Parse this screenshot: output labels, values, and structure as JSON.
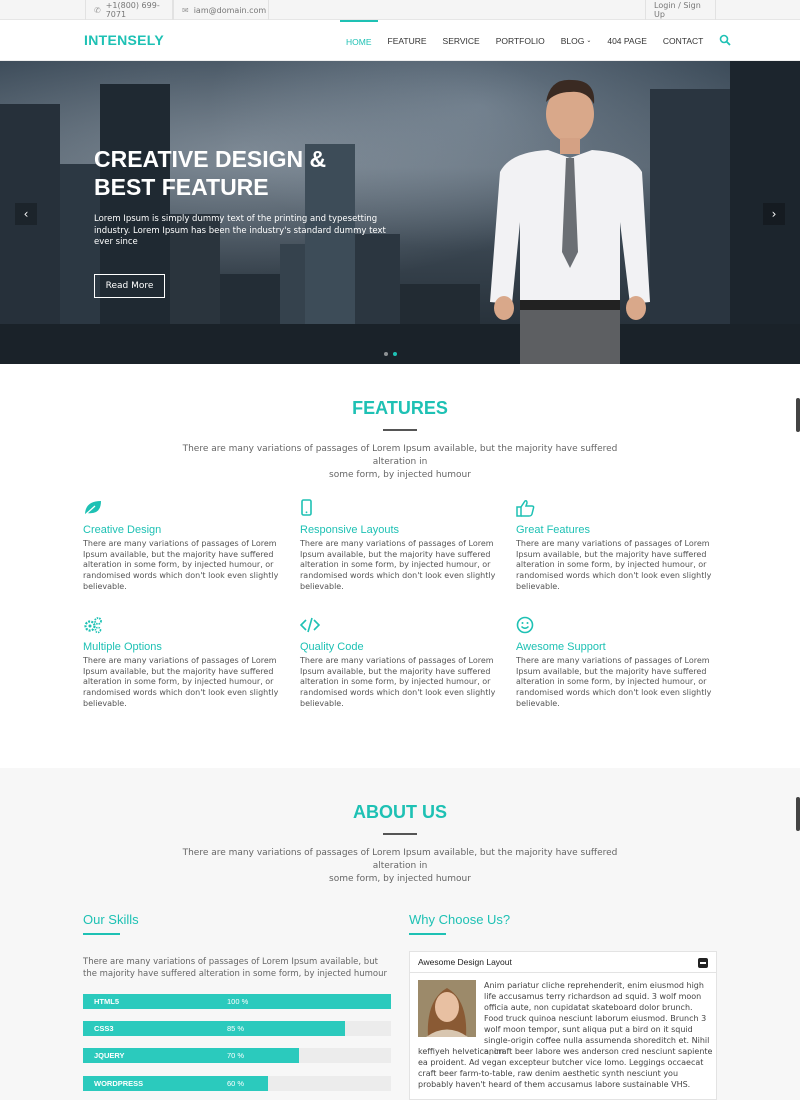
{
  "topbar": {
    "phone": "+1(800) 699-7071",
    "email": "iam@domain.com",
    "auth": "Login / Sign Up"
  },
  "nav": {
    "brand": "INTENSELY",
    "links": [
      "HOME",
      "FEATURE",
      "SERVICE",
      "PORTFOLIO",
      "BLOG",
      "404 PAGE",
      "CONTACT"
    ],
    "active": "HOME"
  },
  "hero": {
    "title_line1": "CREATIVE DESIGN &",
    "title_line2": "BEST FEATURE",
    "text": "Lorem Ipsum is simply dummy text of the printing and typesetting industry. Lorem Ipsum has been the industry's standard dummy text ever since",
    "button": "Read More",
    "slide_count": 2,
    "active_slide": 2
  },
  "features": {
    "title": "FEATURES",
    "subtitle_line1": "There are many variations of passages of Lorem Ipsum available, but the majority have suffered alteration in",
    "subtitle_line2": "some form, by injected humour",
    "items": [
      {
        "title": "Creative Design",
        "icon": "leaf-icon",
        "text": "There are many variations of passages of Lorem Ipsum available, but the majority have suffered alteration in some form, by injected humour, or randomised words which don't look even slightly believable."
      },
      {
        "title": "Responsive Layouts",
        "icon": "mobile-icon",
        "text": "There are many variations of passages of Lorem Ipsum available, but the majority have suffered alteration in some form, by injected humour, or randomised words which don't look even slightly believable."
      },
      {
        "title": "Great Features",
        "icon": "thumbs-up-icon",
        "text": "There are many variations of passages of Lorem Ipsum available, but the majority have suffered alteration in some form, by injected humour, or randomised words which don't look even slightly believable."
      },
      {
        "title": "Multiple Options",
        "icon": "cogs-icon",
        "text": "There are many variations of passages of Lorem Ipsum available, but the majority have suffered alteration in some form, by injected humour, or randomised words which don't look even slightly believable."
      },
      {
        "title": "Quality Code",
        "icon": "code-icon",
        "text": "There are many variations of passages of Lorem Ipsum available, but the majority have suffered alteration in some form, by injected humour, or randomised words which don't look even slightly believable."
      },
      {
        "title": "Awesome Support",
        "icon": "smile-icon",
        "text": "There are many variations of passages of Lorem Ipsum available, but the majority have suffered alteration in some form, by injected humour, or randomised words which don't look even slightly believable."
      }
    ]
  },
  "about": {
    "title": "ABOUT US",
    "subtitle_line1": "There are many variations of passages of Lorem Ipsum available, but the majority have suffered alteration in",
    "subtitle_line2": "some form, by injected humour",
    "skills_title": "Our Skills",
    "skills_text": "There are many variations of passages of Lorem Ipsum available, but the majority have suffered alteration in some form, by injected humour",
    "skills": [
      {
        "name": "HTML5",
        "percent": 100,
        "label": "100 %"
      },
      {
        "name": "CSS3",
        "percent": 85,
        "label": "85 %"
      },
      {
        "name": "JQUERY",
        "percent": 70,
        "label": "70 %"
      },
      {
        "name": "WORDPRESS",
        "percent": 60,
        "label": "60 %"
      }
    ],
    "why_title": "Why Choose Us?",
    "accordion_title": "Awesome Design Layout",
    "accordion_text_wrap": "Anim pariatur cliche reprehenderit, enim eiusmod high life accusamus terry richardson ad squid. 3 wolf moon officia aute, non cupidatat skateboard dolor brunch. Food truck quinoa nesciunt laborum eiusmod. Brunch 3 wolf moon tempor, sunt aliqua put a bird on it squid single-origin coffee nulla assumenda shoreditch et. Nihil anim",
    "accordion_text_full": "keffiyeh helvetica, craft beer labore wes anderson cred nesciunt sapiente ea proident. Ad vegan excepteur butcher vice lomo. Leggings occaecat craft beer farm-to-table, raw denim aesthetic synth nesciunt you probably haven't heard of them accusamus labore sustainable VHS."
  },
  "colors": {
    "accent": "#1ec1b4",
    "skill_bar": "#2bcabd"
  }
}
